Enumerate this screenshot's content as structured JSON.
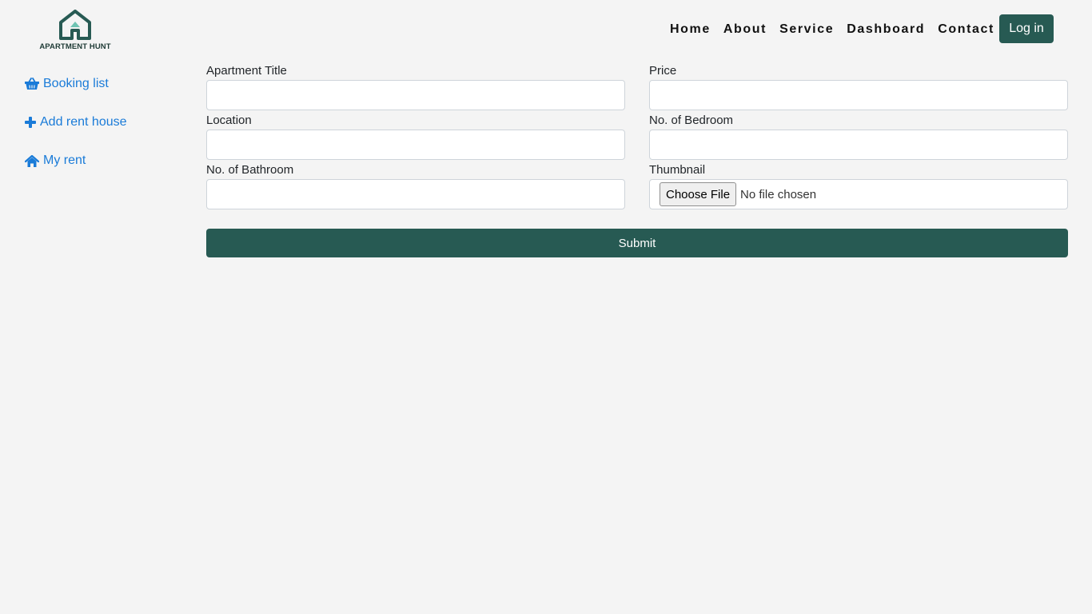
{
  "brand": {
    "name": "APARTMENT HUNT",
    "colors": {
      "primary": "#275a53",
      "accent": "#6fc3b2",
      "link": "#1a7bd8"
    }
  },
  "nav": {
    "items": [
      {
        "label": "Home"
      },
      {
        "label": "About"
      },
      {
        "label": "Service"
      },
      {
        "label": "Dashboard"
      },
      {
        "label": "Contact"
      }
    ],
    "login_label": "Log in"
  },
  "sidebar": {
    "items": [
      {
        "label": "Booking list",
        "icon": "shopping-basket-icon"
      },
      {
        "label": "Add rent house",
        "icon": "plus-icon"
      },
      {
        "label": "My rent",
        "icon": "home-icon"
      }
    ]
  },
  "form": {
    "fields": [
      {
        "label": "Apartment Title",
        "value": ""
      },
      {
        "label": "Price",
        "value": ""
      },
      {
        "label": "Location",
        "value": ""
      },
      {
        "label": "No. of Bedroom",
        "value": ""
      },
      {
        "label": "No. of Bathroom",
        "value": ""
      },
      {
        "label": "Thumbnail",
        "button": "Choose File",
        "status": "No file chosen"
      }
    ],
    "submit_label": "Submit"
  }
}
